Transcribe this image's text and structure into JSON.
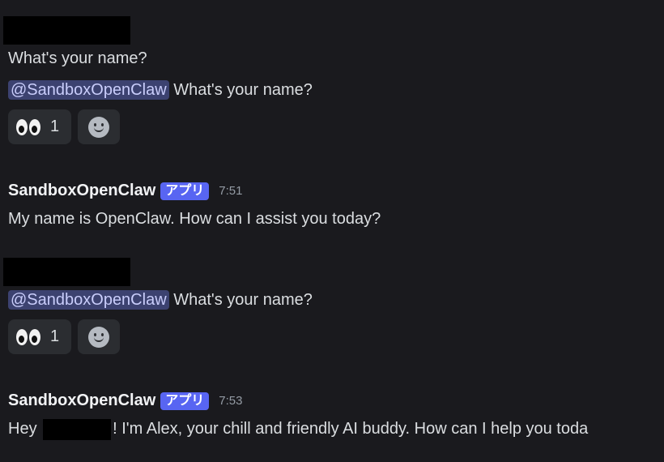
{
  "messages": [
    {
      "type": "user",
      "plain_text": "What's your name?",
      "mention": "@SandboxOpenClaw",
      "text": "What's your name?",
      "reaction": {
        "emoji": "eyes",
        "count": "1"
      }
    },
    {
      "type": "bot",
      "author": "SandboxOpenClaw",
      "badge": "アプリ",
      "time": "7:51",
      "text": "My name is OpenClaw. How can I assist you today?"
    },
    {
      "type": "user",
      "mention": "@SandboxOpenClaw",
      "text": "What's your name?",
      "reaction": {
        "emoji": "eyes",
        "count": "1"
      }
    },
    {
      "type": "bot",
      "author": "SandboxOpenClaw",
      "badge": "アプリ",
      "time": "7:53",
      "text_before": "Hey ",
      "text_after": "! I'm Alex, your chill and friendly AI buddy. How can I help you toda"
    }
  ],
  "colors": {
    "background": "#1a1a1e",
    "mention_bg": "#3c4270",
    "badge": "#5865f2",
    "reaction_bg": "#2b2d31"
  }
}
